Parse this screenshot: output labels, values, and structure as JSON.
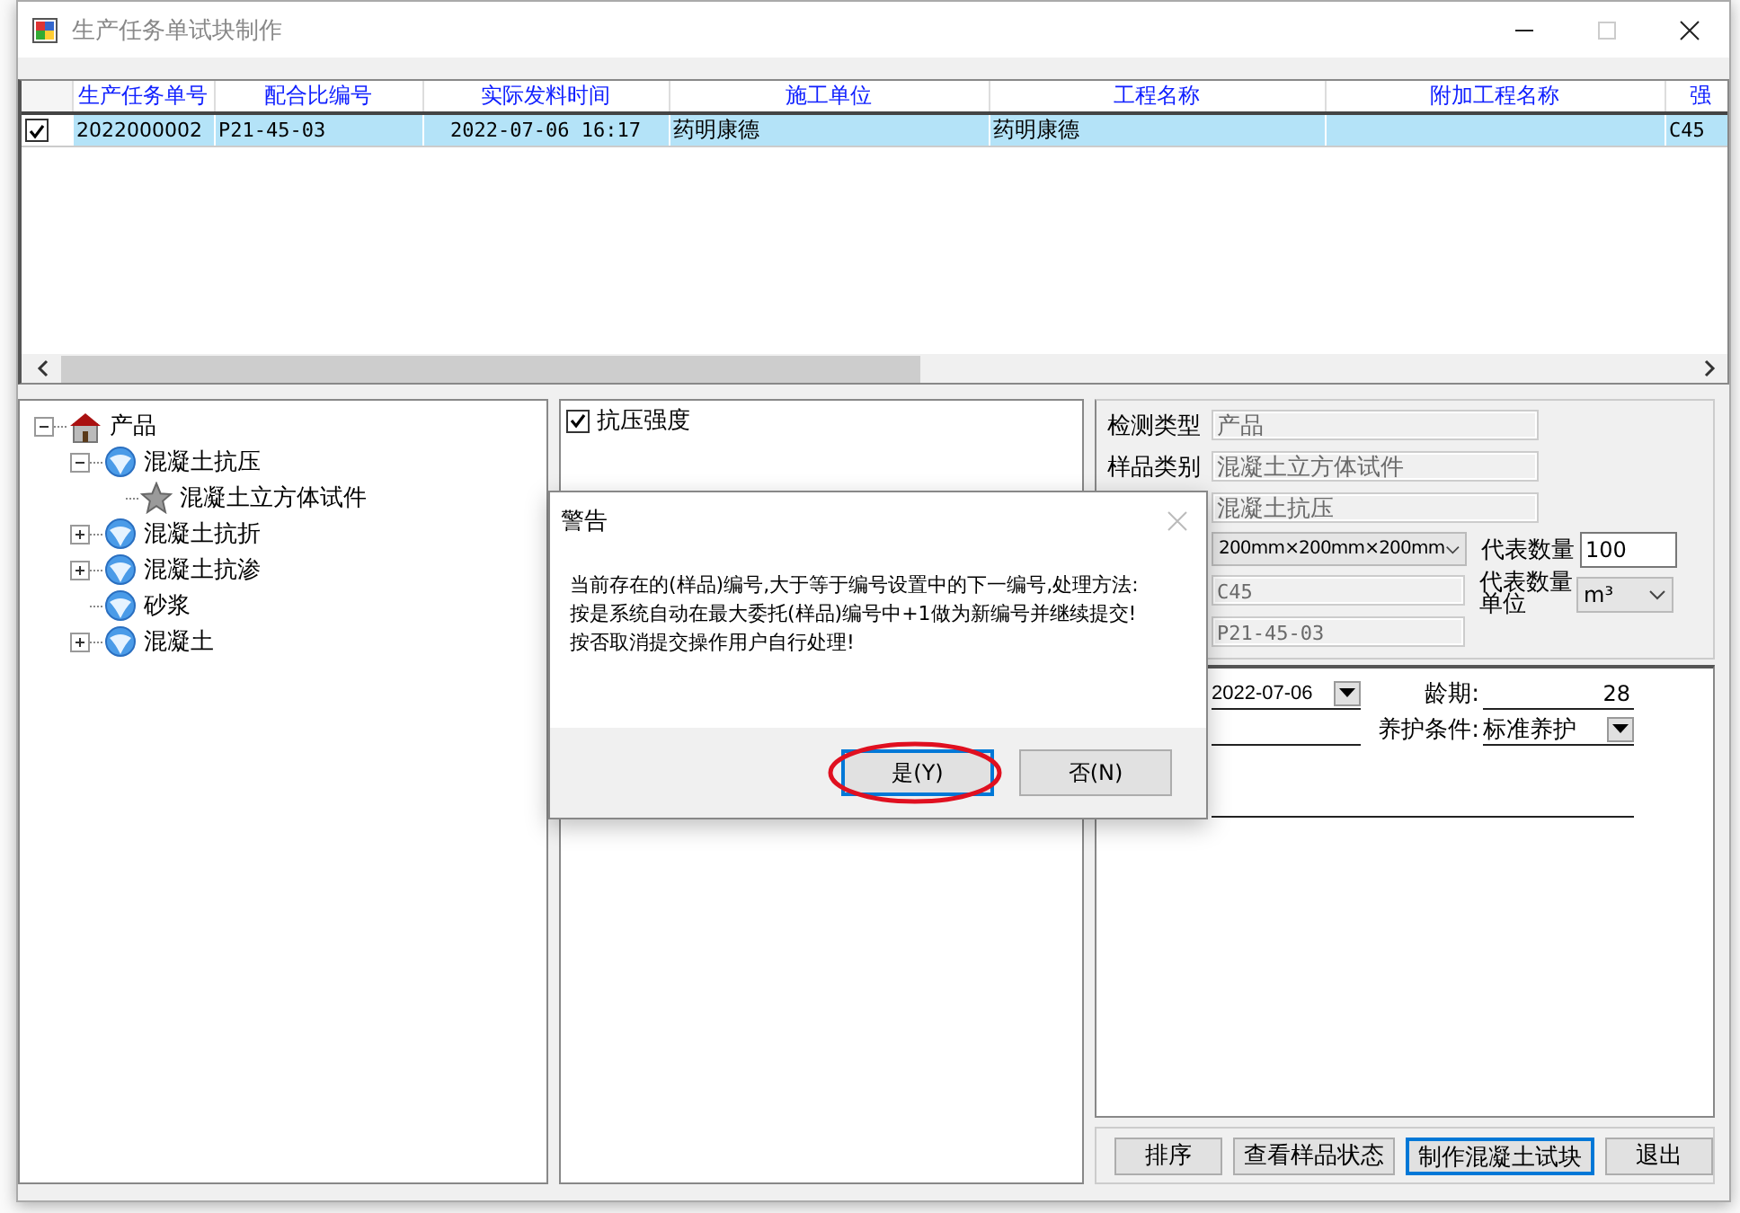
{
  "window": {
    "title": "生产任务单试块制作"
  },
  "grid": {
    "columns": [
      "生产任务单号",
      "配合比编号",
      "实际发料时间",
      "施工单位",
      "工程名称",
      "附加工程名称",
      "强"
    ],
    "rows": [
      {
        "checked": true,
        "selected": true,
        "cells": [
          "2022000002",
          "P21-45-03",
          "2022-07-06 16:17",
          "药明康德",
          "药明康德",
          null,
          "C45"
        ]
      }
    ]
  },
  "tree": [
    {
      "label": "产品",
      "kind": "house",
      "expanded": true,
      "children": [
        {
          "label": "混凝土抗压",
          "kind": "globe",
          "expanded": true,
          "children": [
            {
              "label": "混凝土立方体试件",
              "kind": "star"
            }
          ]
        },
        {
          "label": "混凝土抗折",
          "kind": "globe",
          "expanded": false
        },
        {
          "label": "混凝土抗渗",
          "kind": "globe",
          "expanded": false
        },
        {
          "label": "砂浆",
          "kind": "globe"
        },
        {
          "label": "混凝土",
          "kind": "globe",
          "expanded": false
        }
      ]
    }
  ],
  "test_items": [
    {
      "label": "抗压强度",
      "checked": true
    }
  ],
  "sample_form": {
    "fields": [
      {
        "label": "检测类型",
        "value": "产品",
        "kind": "text"
      },
      {
        "label": "样品类别",
        "value": "混凝土立方体试件",
        "kind": "text"
      },
      {
        "value": "混凝土抗压",
        "kind": "text"
      },
      {
        "value": "200mm×200mm×200mm",
        "kind": "select"
      },
      {
        "value": "C45",
        "kind": "short"
      },
      {
        "value": "P21-45-03",
        "kind": "short"
      }
    ],
    "quantity_label": "代表数量",
    "quantity": "100",
    "unit_label": "代表数量单位",
    "unit": "m³"
  },
  "schedule": {
    "date": "2022-07-06",
    "age_label": "龄期:",
    "age": "28",
    "curing_label": "养护条件:",
    "curing": "标准养护"
  },
  "buttons": [
    {
      "label": "排序",
      "focused": false
    },
    {
      "label": "查看样品状态",
      "focused": false
    },
    {
      "label": "制作混凝土试块",
      "focused": true
    },
    {
      "label": "退出",
      "focused": false
    }
  ],
  "dialog": {
    "title": "警告",
    "lines": [
      "当前存在的(样品)编号,大于等于编号设置中的下一编号,处理方法:",
      "按是系统自动在最大委托(样品)编号中+1做为新编号并继续提交!",
      "按否取消提交操作用户自行处理!"
    ],
    "buttons": [
      {
        "label": "是(Y)",
        "focused": true,
        "highlighted": true
      },
      {
        "label": "否(N)",
        "focused": false,
        "highlighted": false
      }
    ]
  }
}
